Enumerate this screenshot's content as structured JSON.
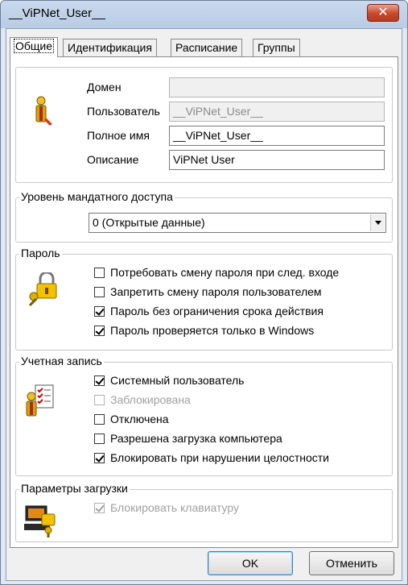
{
  "window": {
    "title": "__ViPNet_User__",
    "close_glyph": "✕"
  },
  "tabs": [
    {
      "label": "Общие",
      "active": true
    },
    {
      "label": "Идентификация",
      "active": false
    },
    {
      "label": "Расписание",
      "active": false
    },
    {
      "label": "Группы",
      "active": false
    }
  ],
  "user": {
    "domain_label": "Домен",
    "domain_value": "",
    "username_label": "Пользователь",
    "username_value": "__ViPNet_User__",
    "fullname_label": "Полное имя",
    "fullname_value": "__ViPNet_User__",
    "description_label": "Описание",
    "description_value": "ViPNet User",
    "icon": "user-icon"
  },
  "access_level": {
    "legend": "Уровень мандатного доступа",
    "selected": "0 (Открытые данные)"
  },
  "password": {
    "legend": "Пароль",
    "icon": "lock-key-icon",
    "options": [
      {
        "label": "Потребовать смену пароля при след. входе",
        "checked": false,
        "disabled": false
      },
      {
        "label": "Запретить смену пароля пользователем",
        "checked": false,
        "disabled": false
      },
      {
        "label": "Пароль без ограничения срока действия",
        "checked": true,
        "disabled": false
      },
      {
        "label": "Пароль проверяется только в Windows",
        "checked": true,
        "disabled": false
      }
    ]
  },
  "account": {
    "legend": "Учетная запись",
    "icon": "user-checklist-icon",
    "options": [
      {
        "label": "Системный пользователь",
        "checked": true,
        "disabled": false
      },
      {
        "label": "Заблокирована",
        "checked": false,
        "disabled": true
      },
      {
        "label": "Отключена",
        "checked": false,
        "disabled": false
      },
      {
        "label": "Разрешена загрузка компьютера",
        "checked": false,
        "disabled": false
      },
      {
        "label": "Блокировать при нарушении целостности",
        "checked": true,
        "disabled": false
      }
    ]
  },
  "boot": {
    "legend": "Параметры загрузки",
    "icon": "computer-key-icon",
    "options": [
      {
        "label": "Блокировать клавиатуру",
        "checked": true,
        "disabled": true
      }
    ]
  },
  "buttons": {
    "ok": "OK",
    "cancel": "Отменить"
  },
  "colors": {
    "accent": "#3c7fb1",
    "close": "#c9472b"
  }
}
